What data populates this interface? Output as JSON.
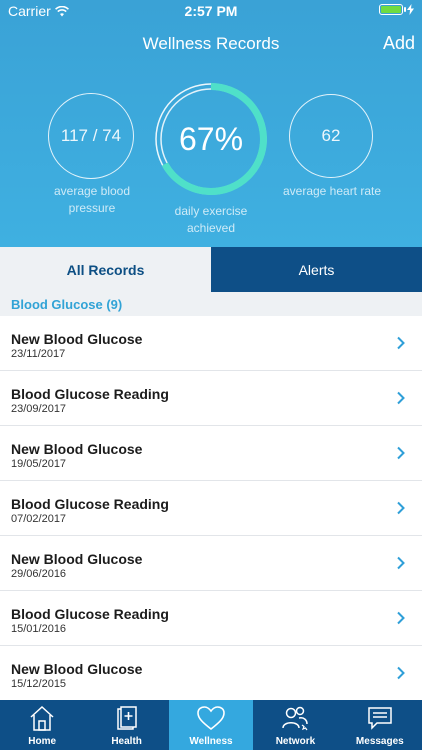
{
  "status_bar": {
    "carrier": "Carrier",
    "time": "2:57 PM"
  },
  "nav": {
    "title": "Wellness Records",
    "add_label": "Add"
  },
  "metrics": {
    "blood_pressure": {
      "value": "117 / 74",
      "label_line1": "average blood",
      "label_line2": "pressure"
    },
    "exercise": {
      "value": "67%",
      "progress": 0.67,
      "label_line1": "daily exercise",
      "label_line2": "achieved"
    },
    "heart_rate": {
      "value": "62",
      "label": "average heart rate"
    }
  },
  "tabs": {
    "all_records": "All Records",
    "alerts": "Alerts"
  },
  "section": {
    "title": "Blood Glucose (9)"
  },
  "records": [
    {
      "title": "New Blood Glucose",
      "date": "23/11/2017"
    },
    {
      "title": "Blood Glucose Reading",
      "date": "23/09/2017"
    },
    {
      "title": "New Blood Glucose",
      "date": "19/05/2017"
    },
    {
      "title": "Blood Glucose Reading",
      "date": "07/02/2017"
    },
    {
      "title": "New Blood Glucose",
      "date": "29/06/2016"
    },
    {
      "title": "Blood Glucose Reading",
      "date": "15/01/2016"
    },
    {
      "title": "New Blood Glucose",
      "date": "15/12/2015"
    }
  ],
  "tabbar": {
    "home": "Home",
    "health": "Health",
    "wellness": "Wellness",
    "network": "Network",
    "messages": "Messages"
  },
  "colors": {
    "hero_blue": "#3fb0e1",
    "navy": "#0e4f87",
    "accent_teal": "#4fe0c9",
    "section_text": "#31a3d6"
  }
}
